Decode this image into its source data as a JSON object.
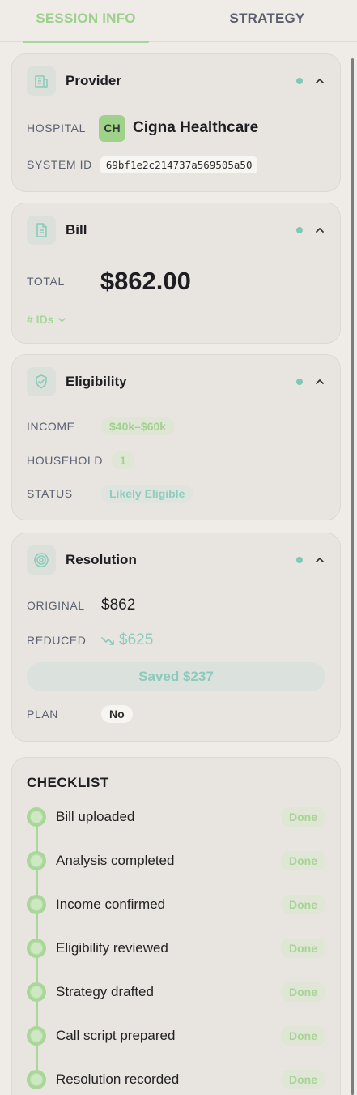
{
  "tabs": {
    "session_info": "SESSION INFO",
    "strategy": "STRATEGY"
  },
  "colors": {
    "accent_green": "#a8d69a",
    "accent_teal": "#7ec8b4",
    "card_bg": "#e8e5e0",
    "page_bg": "#efebe7"
  },
  "provider": {
    "title": "Provider",
    "icon": "hospital-icon",
    "hospital_label": "HOSPITAL",
    "hospital_initials": "CH",
    "hospital_name": "Cigna Healthcare",
    "system_id_label": "SYSTEM ID",
    "system_id": "69bf1e2c214737a569505a50"
  },
  "bill": {
    "title": "Bill",
    "icon": "document-icon",
    "total_label": "TOTAL",
    "total": "$862.00",
    "ids_toggle": "# IDs"
  },
  "eligibility": {
    "title": "Eligibility",
    "icon": "shield-check-icon",
    "income_label": "INCOME",
    "income": "$40k–$60k",
    "household_label": "HOUSEHOLD",
    "household": "1",
    "status_label": "STATUS",
    "status": "Likely Eligible"
  },
  "resolution": {
    "title": "Resolution",
    "icon": "target-icon",
    "original_label": "ORIGINAL",
    "original": "$862",
    "reduced_label": "REDUCED",
    "reduced": "$625",
    "saved": "Saved $237",
    "plan_label": "PLAN",
    "plan": "No"
  },
  "checklist": {
    "title": "CHECKLIST",
    "items": [
      {
        "label": "Bill uploaded",
        "status": "Done"
      },
      {
        "label": "Analysis completed",
        "status": "Done"
      },
      {
        "label": "Income confirmed",
        "status": "Done"
      },
      {
        "label": "Eligibility reviewed",
        "status": "Done"
      },
      {
        "label": "Strategy drafted",
        "status": "Done"
      },
      {
        "label": "Call script prepared",
        "status": "Done"
      },
      {
        "label": "Resolution recorded",
        "status": "Done"
      }
    ]
  }
}
